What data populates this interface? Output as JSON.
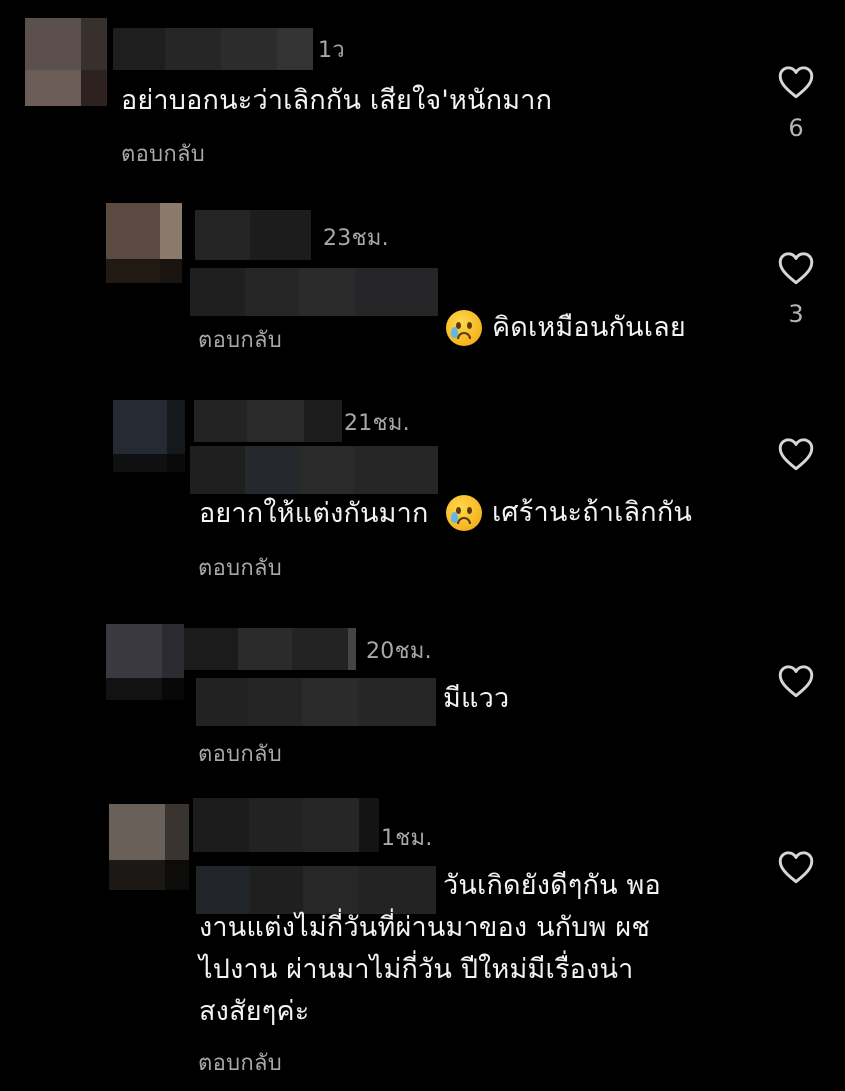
{
  "comments": [
    {
      "timestamp": "1ว",
      "text": "อย่าบอกนะว่าเลิกกัน เสียใจ'หนักมาก",
      "reply_label": "ตอบกลับ",
      "likes": "6",
      "heart_icon": "heart-outline-icon"
    },
    {
      "timestamp": "23ชม.",
      "text_line1": "คิดเหมือนกันเลย",
      "emoji": "crying-face-emoji",
      "reply_label": "ตอบกลับ",
      "likes": "3",
      "heart_icon": "heart-outline-icon"
    },
    {
      "timestamp": "21ชม.",
      "text_line1": "เศร้านะถ้าเลิกกัน",
      "text_line2": "อยากให้แต่งกันมาก",
      "emoji": "crying-face-emoji",
      "reply_label": "ตอบกลับ",
      "heart_icon": "heart-outline-icon"
    },
    {
      "timestamp": "20ชม.",
      "text_line1": "มีแวว",
      "reply_label": "ตอบกลับ",
      "heart_icon": "heart-outline-icon"
    },
    {
      "timestamp": "1ชม.",
      "text_line1": "วันเกิดยังดีๆกัน พอ",
      "text_rest": "งานแต่งไม่กี่วันที่ผ่านมาของ นกับพ ผช\nไปงาน ผ่านมาไม่กี่วัน ปีใหม่มีเรื่องน่า\nสงสัยๆค่ะ",
      "reply_label": "ตอบกลับ",
      "heart_icon": "heart-outline-icon"
    }
  ],
  "colors": {
    "background": "#000000",
    "text": "#f3f3f3",
    "secondary_text": "#a8a8a8"
  }
}
